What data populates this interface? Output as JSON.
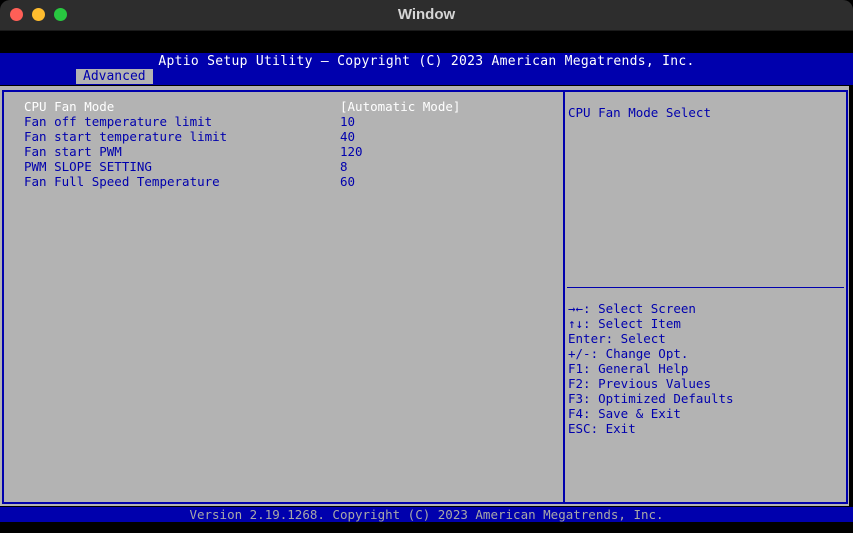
{
  "window": {
    "title": "Window"
  },
  "header": {
    "title": "Aptio Setup Utility – Copyright (C) 2023 American Megatrends, Inc.",
    "tab": "Advanced"
  },
  "settings": [
    {
      "label": "CPU Fan Mode",
      "value": "[Automatic Mode]"
    },
    {
      "label": "Fan off temperature limit",
      "value": "10"
    },
    {
      "label": "Fan start temperature limit",
      "value": "40"
    },
    {
      "label": "Fan start PWM",
      "value": "120"
    },
    {
      "label": "PWM SLOPE SETTING",
      "value": "8"
    },
    {
      "label": "Fan Full Speed Temperature",
      "value": "60"
    }
  ],
  "help": {
    "text": "CPU Fan Mode Select"
  },
  "keys": [
    "→←: Select Screen",
    "↑↓: Select Item",
    "Enter: Select",
    "+/-: Change Opt.",
    "F1: General Help",
    "F2: Previous Values",
    "F3: Optimized Defaults",
    "F4: Save & Exit",
    "ESC: Exit"
  ],
  "footer": {
    "text": "Version 2.19.1268. Copyright (C) 2023 American Megatrends, Inc."
  },
  "colors": {
    "bios_blue": "#0000ad",
    "panel_gray": "#b3b3b3"
  }
}
